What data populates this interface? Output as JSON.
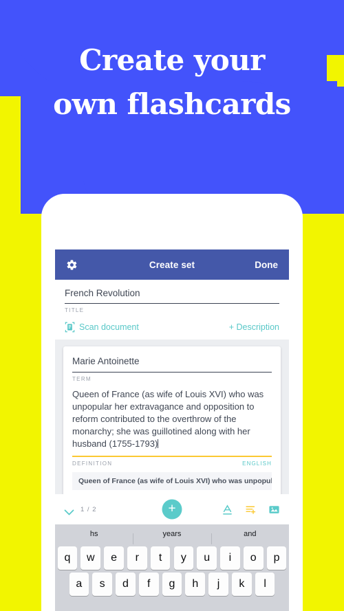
{
  "promo": {
    "headline_line1": "Create your",
    "headline_line2": "own flashcards",
    "background_color": "#f2f500",
    "blob_color": "#4353fb",
    "headline_color": "#ffffff"
  },
  "app": {
    "appbar": {
      "settings_icon": "gear-icon",
      "title": "Create set",
      "done_label": "Done",
      "background_color": "#4458a9"
    },
    "set_meta": {
      "title_value": "French Revolution",
      "title_label": "TITLE",
      "scan_icon": "scan-document-icon",
      "scan_label": "Scan document",
      "description_label": "+ Description",
      "accent_color": "#59c8c8"
    },
    "card": {
      "term_value": "Marie Antoinette",
      "term_label": "TERM",
      "definition_value": "Queen of France (as wife of Louis XVI) who was unpopular her extravagance and opposition to reform contributed to the overthrow of the monarchy; she was guillotined along with her husband (1755-1793)",
      "definition_label": "DEFINITION",
      "language_label": "ENGLISH",
      "underline_color": "#fbc932",
      "suggestion": "Queen of France (as wife of Louis XVI) who was unpopular he…"
    },
    "toolbar": {
      "collapse_icon": "chevron-down-icon",
      "page_count": "1 / 2",
      "add_card_icon": "plus-icon",
      "text_format_icon": "underline-a-icon",
      "list_add_icon": "list-add-icon",
      "image_icon": "image-icon",
      "fab_color": "#5bcbca",
      "list_icon_color": "#fbc932"
    },
    "keyboard": {
      "suggestions": [
        "hs",
        "years",
        "and"
      ],
      "row1": [
        "q",
        "w",
        "e",
        "r",
        "t",
        "y",
        "u",
        "i",
        "o",
        "p"
      ],
      "row2": [
        "a",
        "s",
        "d",
        "f",
        "g",
        "h",
        "j",
        "k",
        "l"
      ],
      "background_color": "#d1d3d9"
    }
  }
}
